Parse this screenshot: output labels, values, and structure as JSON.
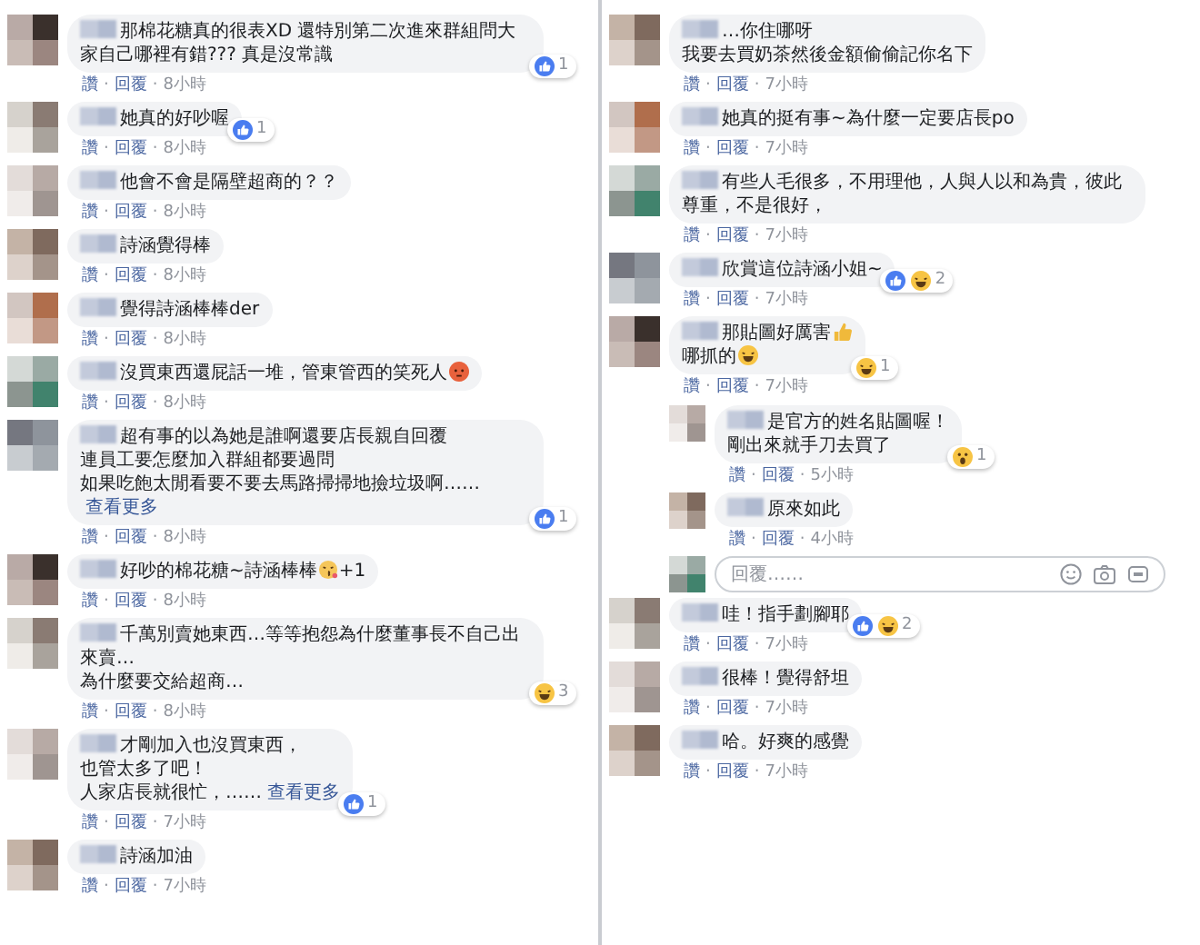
{
  "columns": [
    {
      "comments": [
        {
          "lines": [
            {
              "text": "那棉花糖真的很表XD 還特別第二次進來群組問大家自己哪裡有錯??? 真是沒常識"
            }
          ],
          "reaction": {
            "icons": [
              {
                "kind": "like"
              }
            ],
            "count": "1"
          },
          "actions": {
            "like": "讚",
            "reply": "回覆",
            "time": "8小時",
            "separator": "·"
          }
        },
        {
          "lines": [
            {
              "text": "她真的好吵喔"
            }
          ],
          "reaction": {
            "icons": [
              {
                "kind": "like"
              }
            ],
            "count": "1"
          },
          "actions": {
            "like": "讚",
            "reply": "回覆",
            "time": "8小時",
            "separator": "·"
          }
        },
        {
          "lines": [
            {
              "text": "他會不會是隔壁超商的？？"
            }
          ],
          "actions": {
            "like": "讚",
            "reply": "回覆",
            "time": "8小時",
            "separator": "·"
          }
        },
        {
          "lines": [
            {
              "text": "詩涵覺得棒"
            }
          ],
          "actions": {
            "like": "讚",
            "reply": "回覆",
            "time": "8小時",
            "separator": "·"
          }
        },
        {
          "lines": [
            {
              "text": "覺得詩涵棒棒der"
            }
          ],
          "actions": {
            "like": "讚",
            "reply": "回覆",
            "time": "8小時",
            "separator": "·"
          }
        },
        {
          "lines": [
            {
              "text": "沒買東西還屁話一堆，管東管西的笑死人",
              "emoji": {
                "kind": "angry"
              }
            }
          ],
          "actions": {
            "like": "讚",
            "reply": "回覆",
            "time": "8小時",
            "separator": "·"
          }
        },
        {
          "lines": [
            {
              "text": "超有事的以為她是誰啊還要店長親自回覆"
            },
            {
              "text": "連員工要怎麼加入群組都要過問"
            },
            {
              "text": "如果吃飽太閒看要不要去馬路掃掃地撿垃圾啊……"
            }
          ],
          "see_more": "查看更多",
          "reaction": {
            "icons": [
              {
                "kind": "like"
              }
            ],
            "count": "1"
          },
          "actions": {
            "like": "讚",
            "reply": "回覆",
            "time": "8小時",
            "separator": "·"
          }
        },
        {
          "lines": [
            {
              "text": "好吵的棉花糖~詩涵棒棒",
              "emoji": {
                "kind": "kiss"
              },
              "suffix": "+1"
            }
          ],
          "actions": {
            "like": "讚",
            "reply": "回覆",
            "time": "8小時",
            "separator": "·"
          }
        },
        {
          "lines": [
            {
              "text": "千萬別賣她東西…等等抱怨為什麼董事長不自己出來賣…"
            },
            {
              "text": "為什麼要交給超商…"
            }
          ],
          "reaction": {
            "icons": [
              {
                "kind": "haha"
              }
            ],
            "count": "3"
          },
          "actions": {
            "like": "讚",
            "reply": "回覆",
            "time": "8小時",
            "separator": "·"
          }
        },
        {
          "lines": [
            {
              "text": "才剛加入也沒買東西，"
            },
            {
              "text": "也管太多了吧！"
            },
            {
              "text": "人家店長就很忙，……"
            }
          ],
          "see_more": "查看更多",
          "reaction": {
            "icons": [
              {
                "kind": "like"
              }
            ],
            "count": "1"
          },
          "actions": {
            "like": "讚",
            "reply": "回覆",
            "time": "7小時",
            "separator": "·"
          }
        },
        {
          "lines": [
            {
              "text": "詩涵加油"
            }
          ],
          "actions": {
            "like": "讚",
            "reply": "回覆",
            "time": "7小時",
            "separator": "·"
          }
        }
      ]
    },
    {
      "comments": [
        {
          "lines": [
            {
              "text": "…你住哪呀"
            },
            {
              "text": "我要去買奶茶然後金額偷偷記你名下"
            }
          ],
          "actions": {
            "like": "讚",
            "reply": "回覆",
            "time": "7小時",
            "separator": "·"
          }
        },
        {
          "lines": [
            {
              "text": "她真的挺有事~為什麼一定要店長po"
            }
          ],
          "actions": {
            "like": "讚",
            "reply": "回覆",
            "time": "7小時",
            "separator": "·"
          }
        },
        {
          "lines": [
            {
              "text": "有些人毛很多，不用理他，人與人以和為貴，彼此尊重，不是很好，"
            }
          ],
          "actions": {
            "like": "讚",
            "reply": "回覆",
            "time": "7小時",
            "separator": "·"
          }
        },
        {
          "lines": [
            {
              "text": "欣賞這位詩涵小姐~"
            }
          ],
          "reaction": {
            "icons": [
              {
                "kind": "like"
              },
              {
                "kind": "haha"
              }
            ],
            "count": "2"
          },
          "actions": {
            "like": "讚",
            "reply": "回覆",
            "time": "7小時",
            "separator": "·"
          }
        },
        {
          "lines": [
            {
              "text": "那貼圖好厲害",
              "emoji": {
                "kind": "thumb"
              }
            },
            {
              "text": "哪抓的",
              "emoji": {
                "kind": "haha"
              }
            }
          ],
          "reaction": {
            "icons": [
              {
                "kind": "haha"
              }
            ],
            "count": "1"
          },
          "actions": {
            "like": "讚",
            "reply": "回覆",
            "time": "7小時",
            "separator": "·"
          },
          "children": [
            {
              "lines": [
                {
                  "text": "是官方的姓名貼圖喔！"
                },
                {
                  "text": "剛出來就手刀去買了"
                }
              ],
              "reaction": {
                "icons": [
                  {
                    "kind": "wow"
                  }
                ],
                "count": "1"
              },
              "actions": {
                "like": "讚",
                "reply": "回覆",
                "time": "5小時",
                "separator": "·"
              }
            },
            {
              "lines": [
                {
                  "text": "原來如此"
                }
              ],
              "actions": {
                "like": "讚",
                "reply": "回覆",
                "time": "4小時",
                "separator": "·"
              }
            }
          ],
          "reply_box": {
            "placeholder": "回覆……"
          }
        },
        {
          "lines": [
            {
              "text": "哇！指手劃腳耶"
            }
          ],
          "reaction": {
            "icons": [
              {
                "kind": "like"
              },
              {
                "kind": "haha"
              }
            ],
            "count": "2"
          },
          "actions": {
            "like": "讚",
            "reply": "回覆",
            "time": "7小時",
            "separator": "·"
          }
        },
        {
          "lines": [
            {
              "text": "很棒！覺得舒坦"
            }
          ],
          "actions": {
            "like": "讚",
            "reply": "回覆",
            "time": "7小時",
            "separator": "·"
          }
        },
        {
          "lines": [
            {
              "text": "哈。好爽的感覺"
            }
          ],
          "actions": {
            "like": "讚",
            "reply": "回覆",
            "time": "7小時",
            "separator": "·"
          }
        }
      ]
    }
  ]
}
